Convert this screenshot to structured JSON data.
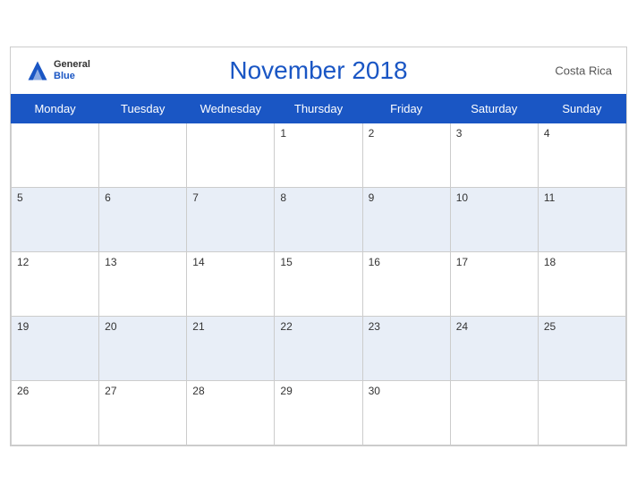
{
  "header": {
    "title": "November 2018",
    "country": "Costa Rica",
    "logo_general": "General",
    "logo_blue": "Blue"
  },
  "weekdays": [
    "Monday",
    "Tuesday",
    "Wednesday",
    "Thursday",
    "Friday",
    "Saturday",
    "Sunday"
  ],
  "weeks": [
    [
      null,
      null,
      null,
      1,
      2,
      3,
      4
    ],
    [
      5,
      6,
      7,
      8,
      9,
      10,
      11
    ],
    [
      12,
      13,
      14,
      15,
      16,
      17,
      18
    ],
    [
      19,
      20,
      21,
      22,
      23,
      24,
      25
    ],
    [
      26,
      27,
      28,
      29,
      30,
      null,
      null
    ]
  ],
  "shaded_rows": [
    1,
    3
  ]
}
